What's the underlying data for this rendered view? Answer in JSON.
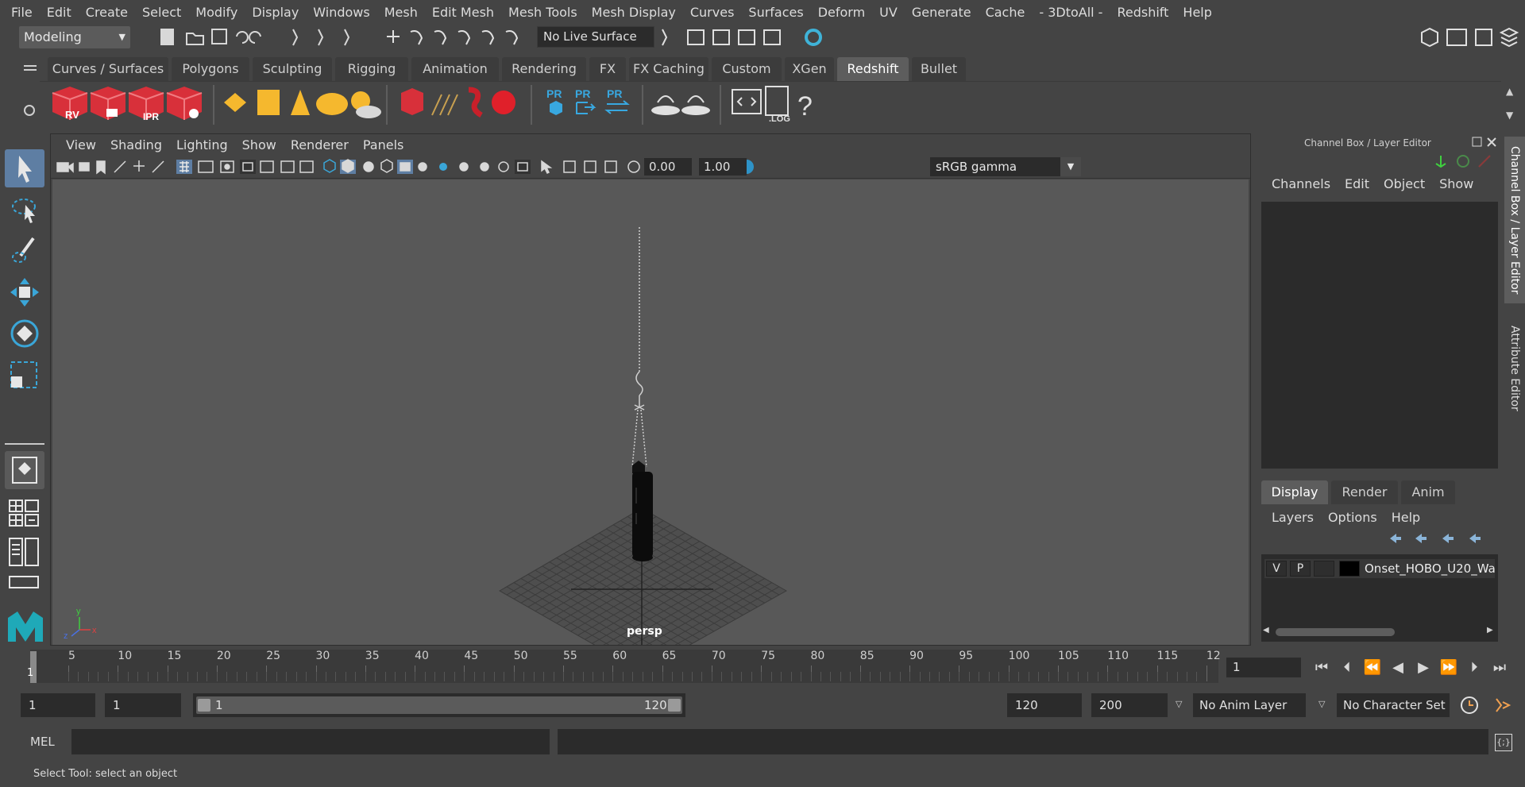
{
  "menubar": [
    "File",
    "Edit",
    "Create",
    "Select",
    "Modify",
    "Display",
    "Windows",
    "Mesh",
    "Edit Mesh",
    "Mesh Tools",
    "Mesh Display",
    "Curves",
    "Surfaces",
    "Deform",
    "UV",
    "Generate",
    "Cache",
    "- 3DtoAll -",
    "Redshift",
    "Help"
  ],
  "status": {
    "mode": "Modeling",
    "live_surface": "No Live Surface"
  },
  "shelf_tabs": [
    "Curves / Surfaces",
    "Polygons",
    "Sculpting",
    "Rigging",
    "Animation",
    "Rendering",
    "FX",
    "FX Caching",
    "Custom",
    "XGen",
    "Redshift",
    "Bullet"
  ],
  "shelf_active": "Redshift",
  "shelf_icons": {
    "rv": "RV",
    "ipr": "IPR",
    "pr": "PR",
    "log": ".LOG",
    "help": "?"
  },
  "viewport": {
    "menu": [
      "View",
      "Shading",
      "Lighting",
      "Show",
      "Renderer",
      "Panels"
    ],
    "exposure": "0.00",
    "gamma_value": "1.00",
    "color_space": "sRGB gamma",
    "camera": "persp",
    "axis": {
      "x": "x",
      "y": "y",
      "z": "z"
    }
  },
  "channel_box": {
    "title": "Channel Box / Layer Editor",
    "menu": [
      "Channels",
      "Edit",
      "Object",
      "Show"
    ]
  },
  "layer_editor": {
    "tabs": [
      "Display",
      "Render",
      "Anim"
    ],
    "active_tab": "Display",
    "menu": [
      "Layers",
      "Options",
      "Help"
    ],
    "layers": [
      {
        "visible": "V",
        "playback": "P",
        "name": "Onset_HOBO_U20_Wa"
      }
    ]
  },
  "side_tabs": [
    "Channel Box / Layer Editor",
    "Attribute Editor"
  ],
  "timeline": {
    "ticks": [
      "5",
      "10",
      "15",
      "20",
      "25",
      "30",
      "35",
      "40",
      "45",
      "50",
      "55",
      "60",
      "65",
      "70",
      "75",
      "80",
      "85",
      "90",
      "95",
      "100",
      "105",
      "110",
      "115",
      "12"
    ],
    "playhead_label": "1",
    "current_frame": "1"
  },
  "range": {
    "start": "1",
    "playback_start": "1",
    "slider_start": "1",
    "slider_end": "120",
    "playback_end": "120",
    "end": "200",
    "anim_layer": "No Anim Layer",
    "character_set": "No Character Set"
  },
  "command": {
    "lang": "MEL"
  },
  "help_line": "Select Tool: select an object"
}
